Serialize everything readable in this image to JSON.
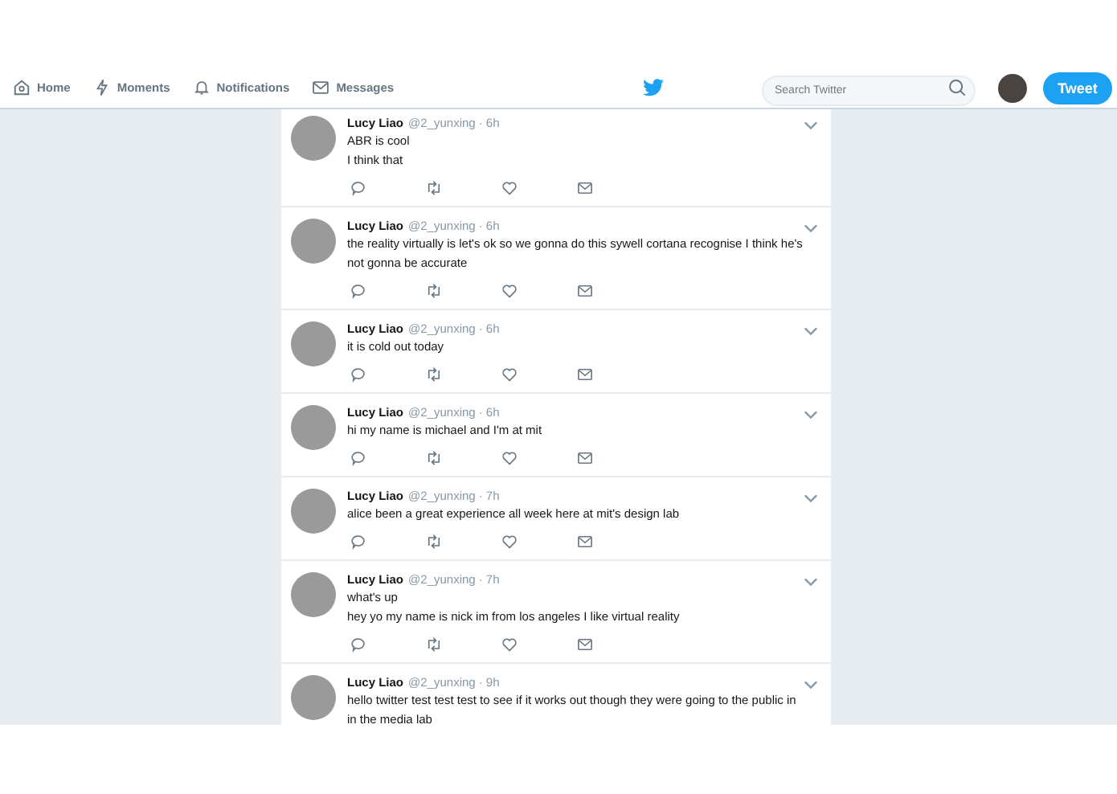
{
  "nav": {
    "items": [
      {
        "label": "Home"
      },
      {
        "label": "Moments"
      },
      {
        "label": "Notifications"
      },
      {
        "label": "Messages"
      }
    ],
    "search": {
      "placeholder": "Search Twitter"
    },
    "tweet_button": "Tweet"
  },
  "tweets": [
    {
      "name": "Lucy Liao",
      "handle": "@2_yunxing",
      "time": "· 6h",
      "lines": [
        "ABR is cool",
        "I think that"
      ],
      "show_actions": true
    },
    {
      "name": "Lucy Liao",
      "handle": "@2_yunxing",
      "time": "· 6h",
      "lines": [
        "the reality virtually is let's ok so we gonna do this sywell cortana recognise I think he's not gonna be accurate"
      ],
      "show_actions": true
    },
    {
      "name": "Lucy Liao",
      "handle": "@2_yunxing",
      "time": "· 6h",
      "lines": [
        "it is cold out today"
      ],
      "show_actions": true
    },
    {
      "name": "Lucy Liao",
      "handle": "@2_yunxing",
      "time": "· 6h",
      "lines": [
        "hi my name is michael and I'm at mit"
      ],
      "show_actions": true
    },
    {
      "name": "Lucy Liao",
      "handle": "@2_yunxing",
      "time": "· 7h",
      "lines": [
        "alice been a great experience all week here at mit's design lab"
      ],
      "show_actions": true
    },
    {
      "name": "Lucy Liao",
      "handle": "@2_yunxing",
      "time": "· 7h",
      "lines": [
        "what's up",
        "hey yo my name is nick im from los angeles I like virtual reality"
      ],
      "show_actions": true
    },
    {
      "name": "Lucy Liao",
      "handle": "@2_yunxing",
      "time": "· 9h",
      "lines": [
        "hello twitter test test test to see if it works out though they were going to the public in in the media lab"
      ],
      "show_actions": false
    }
  ]
}
